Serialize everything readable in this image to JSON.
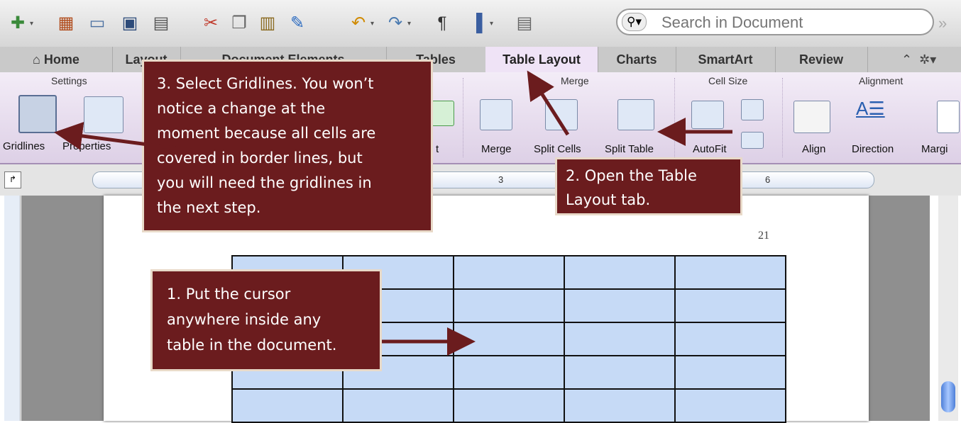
{
  "search": {
    "placeholder": "Search in Document"
  },
  "tabs": [
    {
      "label": "Home",
      "active": false
    },
    {
      "label": "Layout",
      "active": false
    },
    {
      "label": "Document Elements",
      "active": false
    },
    {
      "label": "Tables",
      "active": false
    },
    {
      "label": "Table Layout",
      "active": true
    },
    {
      "label": "Charts",
      "active": false
    },
    {
      "label": "SmartArt",
      "active": false
    },
    {
      "label": "Review",
      "active": false
    }
  ],
  "ribbon": {
    "groups": {
      "settings": "Settings",
      "merge": "Merge",
      "cell_size": "Cell Size",
      "alignment": "Alignment"
    },
    "buttons": {
      "gridlines": "Gridlines",
      "properties": "Properties",
      "partial_text": "t",
      "merge": "Merge",
      "split_cells": "Split Cells",
      "split_table": "Split Table",
      "autofit": "AutoFit",
      "align": "Align",
      "direction": "Direction",
      "margins": "Margi"
    }
  },
  "ruler": {
    "mark_3": "3",
    "mark_6": "6"
  },
  "page": {
    "number": "21"
  },
  "callouts": {
    "step1": [
      "1. Put the cursor",
      "anywhere inside any",
      "table in the document."
    ],
    "step2": [
      "2. Open the Table",
      "Layout tab."
    ],
    "step3": [
      "3. Select Gridlines. You won’t",
      "notice a change at the",
      "moment because all cells are",
      "covered in border lines, but",
      "you will need the gridlines in",
      "the next step."
    ]
  },
  "colors": {
    "callout_bg": "#6b1c1e",
    "table_cell": "#c6daf6",
    "ribbon_bg": "#ddd0e6"
  },
  "icons": [
    "new-doc-icon",
    "templates-icon",
    "open-icon",
    "save-icon",
    "print-icon",
    "cut-icon",
    "copy-icon",
    "paste-icon",
    "format-painter-icon",
    "undo-icon",
    "redo-icon",
    "pilcrow-icon",
    "view-icon",
    "toolbox-icon",
    "search-icon",
    "chevron-right-icon"
  ]
}
